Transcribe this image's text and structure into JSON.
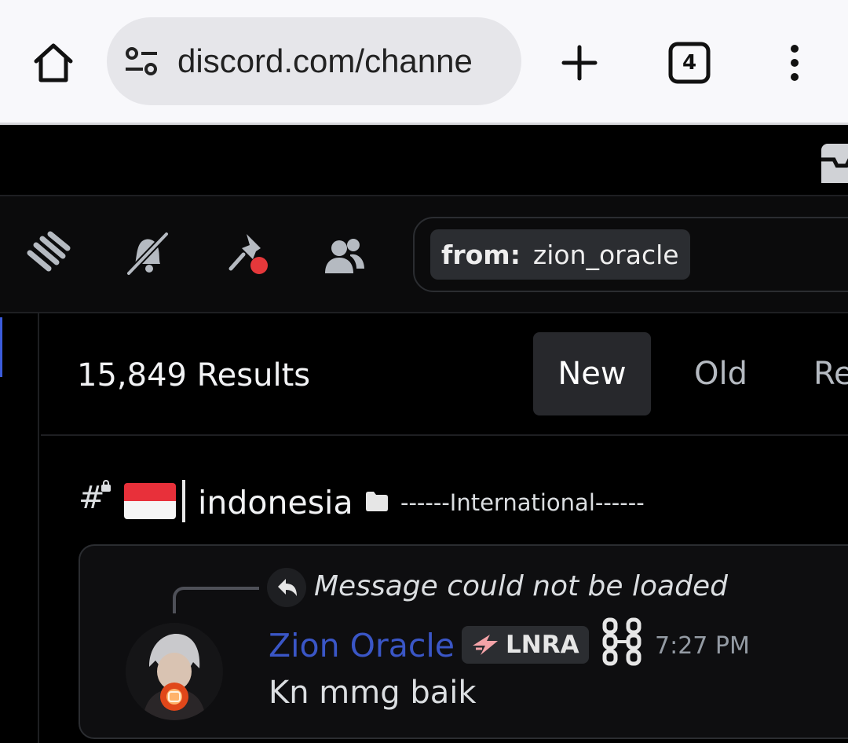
{
  "browser": {
    "url": "discord.com/channe",
    "tab_count": "4",
    "icons": [
      "home-icon",
      "site-settings-icon",
      "new-tab-icon",
      "tab-switcher-icon",
      "more-menu-icon"
    ]
  },
  "toolbar": {
    "icons": [
      "threads-icon",
      "mute-bell-icon",
      "pin-icon",
      "members-icon"
    ],
    "search": {
      "filter_key": "from:",
      "filter_value": "zion_oracle"
    }
  },
  "results": {
    "count_label": "15,849 Results",
    "sort": {
      "new": "New",
      "old": "Old",
      "relevant": "Re"
    }
  },
  "channel": {
    "hash": "#",
    "name": "indonesia",
    "category": "------International------"
  },
  "message": {
    "reply_text": "Message could not be loaded",
    "author": "Zion Oracle",
    "author_color": "#3a56c6",
    "tag": "LNRA",
    "timestamp": "7:27 PM",
    "content": "Kn mmg baik"
  },
  "colors": {
    "accent_blue": "#3b5bdb",
    "surface": "#2b2d31",
    "flag_red": "#e8303a"
  }
}
